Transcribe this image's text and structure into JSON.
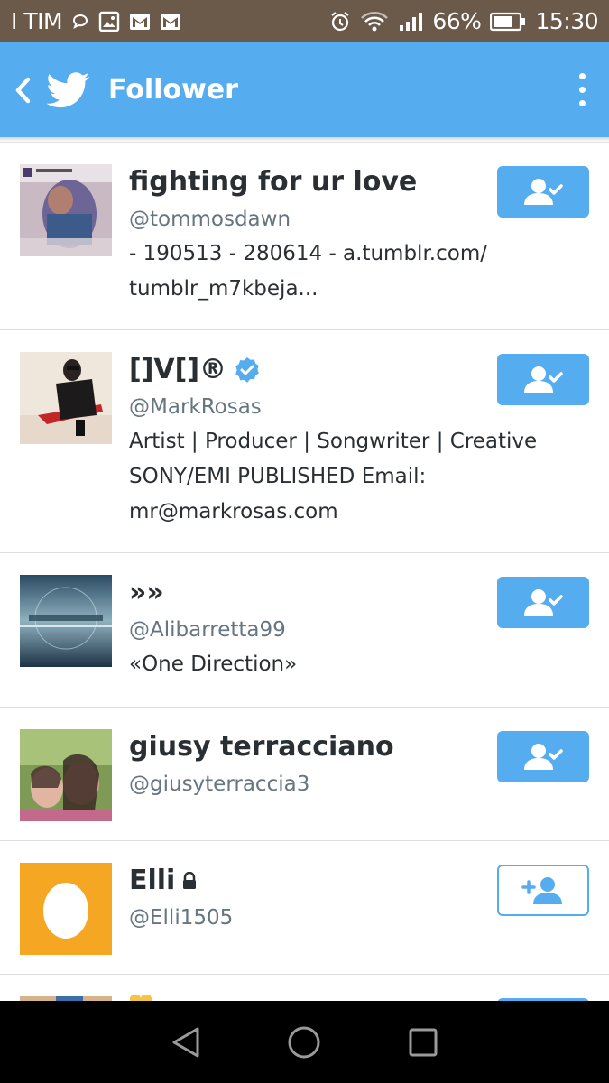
{
  "status_bar": {
    "carrier": "I TIM",
    "battery": "66%",
    "time": "15:30"
  },
  "app_bar": {
    "title": "Follower"
  },
  "followers": [
    {
      "name": "fighting for ur love",
      "handle": "@tommosdawn",
      "bio": "- 190513 - 280614 - a.tumblr.com/ tumblr_m7kbeja...",
      "verified": false,
      "protected": false,
      "following": true
    },
    {
      "name": "[]V[]®",
      "handle": "@MarkRosas",
      "bio": "Artist | Producer | Songwriter | Creative SONY/EMI PUBLISHED Email: mr@markrosas.com",
      "verified": true,
      "protected": false,
      "following": true
    },
    {
      "name": "»»",
      "handle": "@Alibarretta99",
      "bio": "«One Direction»",
      "verified": false,
      "protected": false,
      "following": true
    },
    {
      "name": "giusy terracciano",
      "handle": "@giusyterraccia3",
      "bio": "",
      "verified": false,
      "protected": false,
      "following": true
    },
    {
      "name": "Elli",
      "handle": "@Elli1505",
      "bio": "",
      "verified": false,
      "protected": true,
      "following": false
    }
  ],
  "colors": {
    "twitter_blue": "#55acee",
    "status_bar": "#6b5a4a"
  }
}
